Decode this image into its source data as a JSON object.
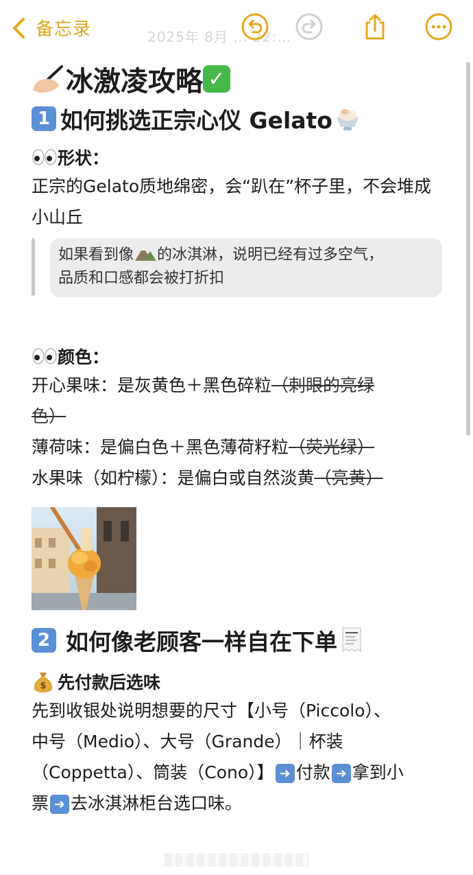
{
  "toolbar": {
    "back_label": "备忘录",
    "faded_date": "2025年 8月 …  22:…"
  },
  "note": {
    "title": "冰激凌攻略",
    "section1": {
      "number": "1",
      "heading": "如何挑选正宗心仪 Gelato",
      "shape": {
        "label": "形状：",
        "text": "正宗的Gelato质地绵密，会“趴在”杯子里，不会堆成小山丘",
        "quote_before": "如果看到像",
        "quote_after": "的冰淇淋，说明已经有过多空气，",
        "quote_line2": "品质和口感都会被打折扣"
      },
      "color": {
        "label": "颜色：",
        "pistachio_main": "开心果味：是灰黄色＋黑色碎粒",
        "pistachio_strike1": "（刺眼的亮绿",
        "pistachio_strike2": "色）",
        "mint_main": "薄荷味：是偏白色＋黑色薄荷籽粒",
        "mint_strike": "（荧光绿）",
        "fruit_main": "水果味（如柠檬）：是偏白或自然淡黄",
        "fruit_strike": "（亮黄）"
      }
    },
    "section2": {
      "number": "2",
      "heading": "如何像老顾客一样自在下单",
      "sub_label": "先付款后选味",
      "line1": "先到收银处说明想要的尺寸【小号（Piccolo）、",
      "line2": "中号（Medio）、大号（Grande）｜杯装",
      "line3a": "（Coppetta）、筒装（Cono）】",
      "line3b": "付款",
      "line3c": "拿到小",
      "line4a": "票",
      "line4b": "去冰淇淋柜台选口味。"
    }
  },
  "icons": {
    "back": "chevron-left-icon",
    "undo": "undo-icon",
    "redo": "redo-icon",
    "share": "share-icon",
    "more": "more-icon"
  },
  "colors": {
    "accent": "#e3a81c",
    "keycap": "#5b8fd6",
    "quote_bg": "#ececee"
  }
}
